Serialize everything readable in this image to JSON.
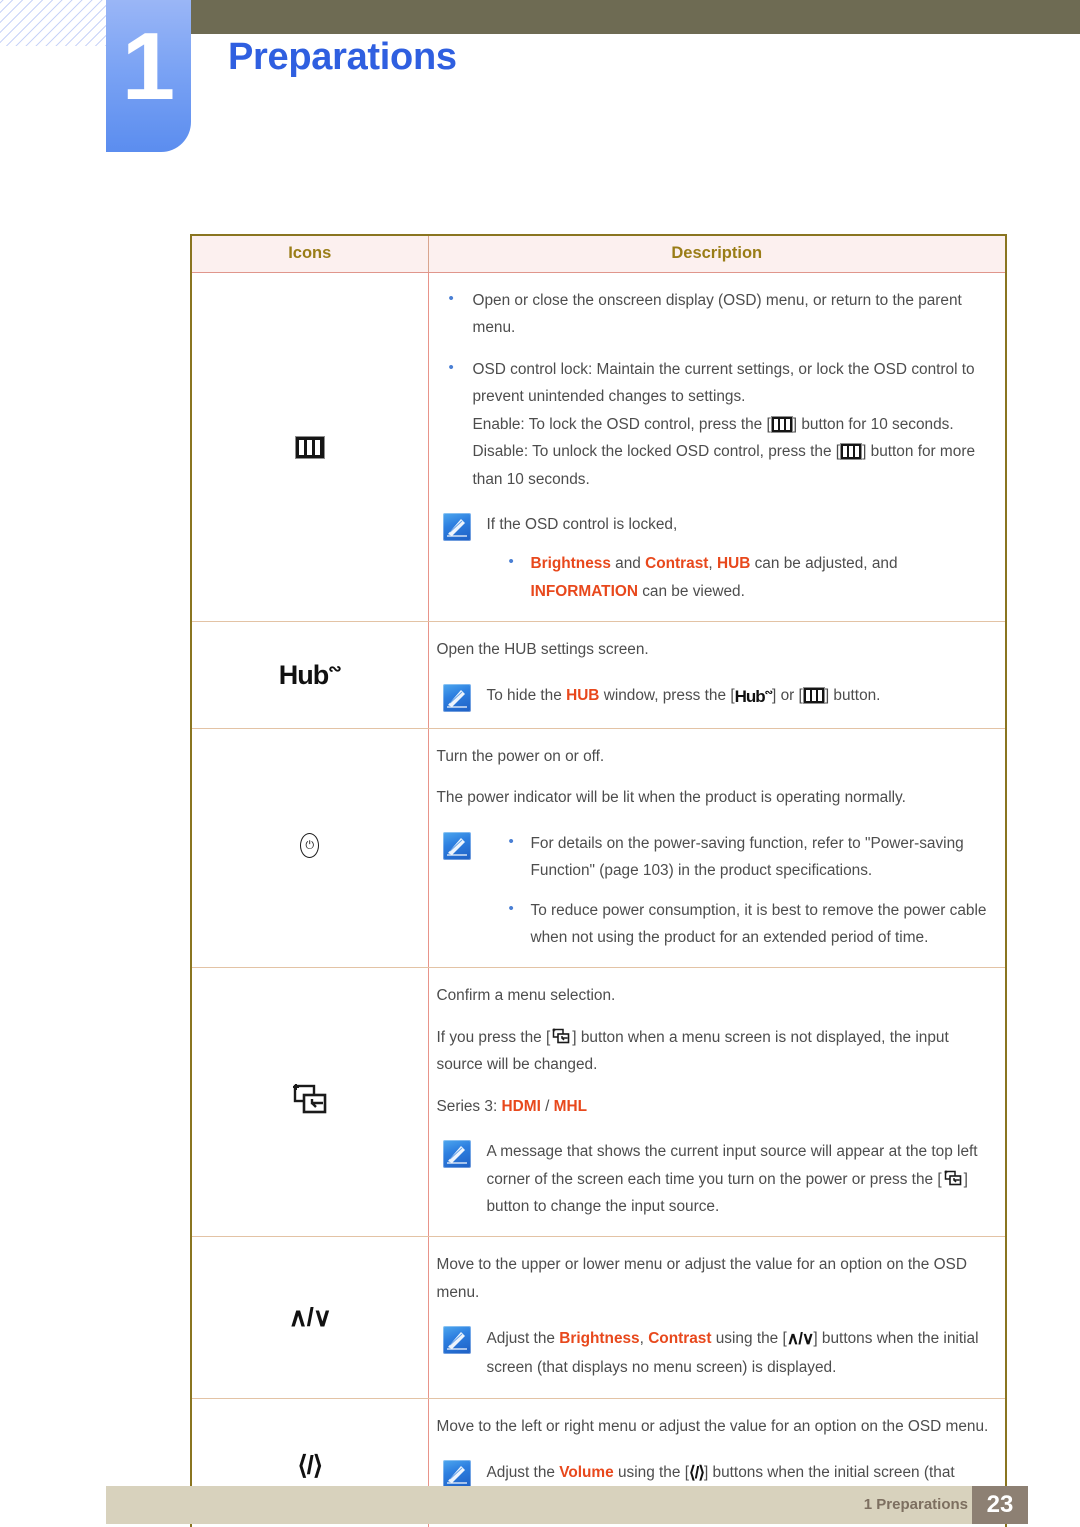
{
  "header": {
    "chapter_number": "1",
    "chapter_title": "Preparations"
  },
  "table": {
    "col_icons": "Icons",
    "col_description": "Description",
    "rows": [
      {
        "icon_name": "osd-menu-icon",
        "icon_glyph": "menu-bars",
        "bullets": [
          "Open or close the onscreen display (OSD) menu, or return to the parent menu.",
          "OSD control lock: Maintain the current settings, or lock the OSD control to prevent unintended changes to settings."
        ],
        "enable_pre": "Enable: To lock the OSD control, press the [",
        "enable_post": "] button for 10 seconds.",
        "disable_pre": "Disable: To unlock the locked OSD control, press the [",
        "disable_post": "] button for more than 10 seconds.",
        "note_text": "If the OSD control is locked,",
        "note_sub_a": "Brightness",
        "note_sub_b": " and ",
        "note_sub_c": "Contrast",
        "note_sub_d": ", ",
        "note_sub_e": "HUB",
        "note_sub_f": " can be adjusted, and ",
        "note_sub_g": "INFORMATION",
        "note_sub_h": " can be viewed."
      },
      {
        "icon_name": "hub-icon",
        "icon_glyph": "Hub",
        "line1": "Open the HUB settings screen.",
        "note_pre": "To hide the ",
        "note_hl": "HUB",
        "note_mid": " window, press the [",
        "note_or": "] or [",
        "note_post": "] button."
      },
      {
        "icon_name": "power-icon",
        "icon_glyph": "power",
        "line1": "Turn the power on or off.",
        "line2": "The power indicator will be lit when the product is operating normally.",
        "note_bullets": [
          "For details on the power-saving function, refer to \"Power-saving Function\" (page 103) in the product specifications.",
          "To reduce power consumption, it is best to remove the power cable when not using the product for an extended period of time."
        ]
      },
      {
        "icon_name": "source-enter-icon",
        "icon_glyph": "source",
        "line1": "Confirm a menu selection.",
        "line2_pre": "If you press the [",
        "line2_post": "] button when a menu screen is not displayed, the input source will be changed.",
        "series_label": "Series 3: ",
        "series_hdmi": "HDMI",
        "series_slash": " / ",
        "series_mhl": "MHL",
        "note_pre": "A message that shows the current input source will appear at the top left corner of the screen each time you turn on the power or press the [",
        "note_post": "] button to change the input source."
      },
      {
        "icon_name": "up-down-icon",
        "icon_glyph": "∧/∨",
        "line1": "Move to the upper or lower menu or adjust the value for an option on the OSD menu.",
        "note_pre": "Adjust the ",
        "note_hl1": "Brightness",
        "note_comma": ", ",
        "note_hl2": "Contrast",
        "note_mid": " using the [",
        "note_post": "] buttons when the initial screen (that displays no menu screen) is displayed."
      },
      {
        "icon_name": "left-right-icon",
        "icon_glyph": "⟨/⟩",
        "line1": "Move to the left or right menu or adjust the value for an option on the OSD menu.",
        "note_pre": "Adjust the ",
        "note_hl": "Volume",
        "note_mid": " using the [",
        "note_post": "] buttons when the initial screen (that displays no menu screen) is displayed."
      }
    ]
  },
  "footer": {
    "label": "1 Preparations",
    "page_number": "23"
  },
  "colors": {
    "accent_blue": "#2f5fe0",
    "highlight_orange": "#e8481c",
    "table_border": "#8a7520",
    "header_bg": "#fcf0ef",
    "header_text": "#9a7d17",
    "olive_bar": "#6e6b53",
    "footer_bg": "#d8d2bd",
    "page_box": "#8d8073"
  }
}
